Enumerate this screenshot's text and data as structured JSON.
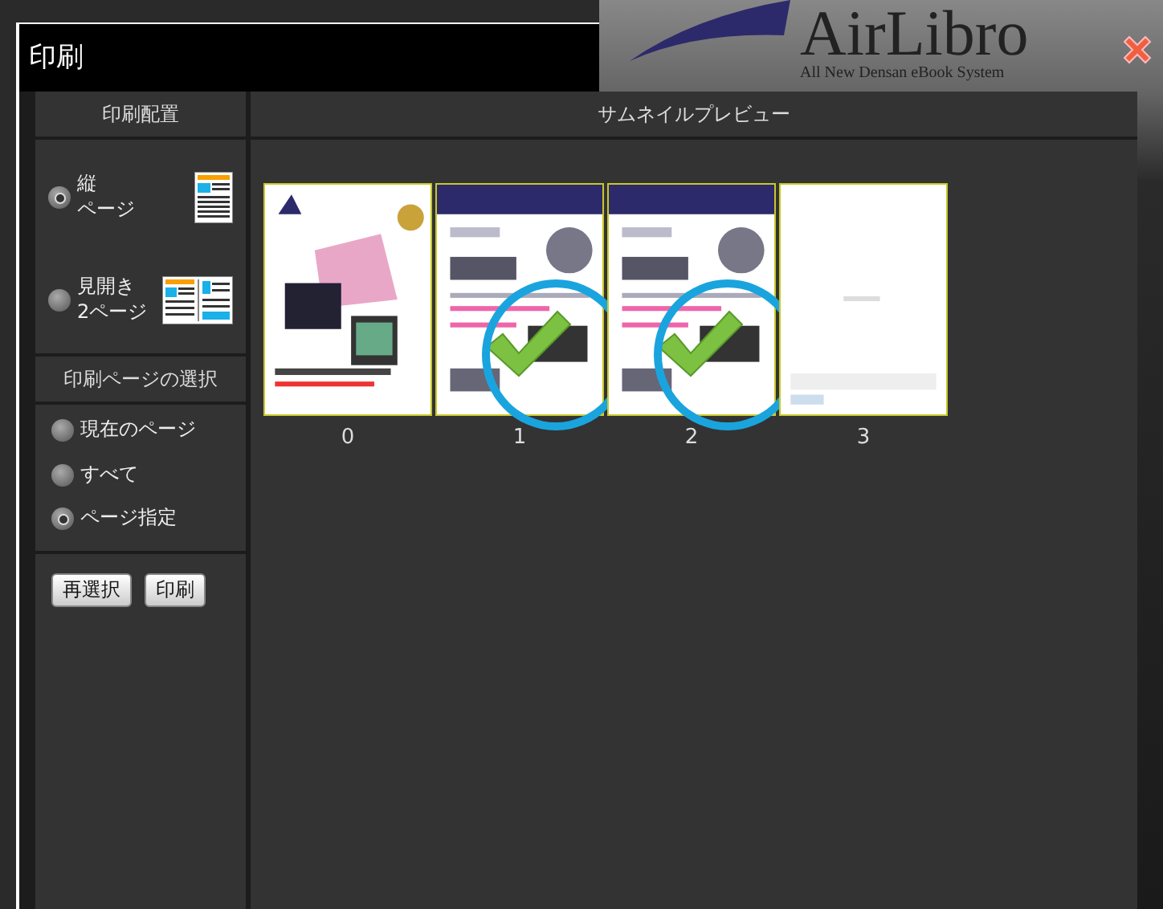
{
  "window": {
    "title": "印刷"
  },
  "background": {
    "logo": "AirLibro",
    "tagline": "All New Densan eBook System"
  },
  "layout_panel": {
    "header": "印刷配置",
    "options": [
      {
        "kind": "single",
        "label_lines": [
          "縦",
          "ページ"
        ],
        "selected": true
      },
      {
        "kind": "spread",
        "label_lines": [
          "見開き",
          "2ページ"
        ],
        "selected": false
      }
    ]
  },
  "page_selection": {
    "header": "印刷ページの選択",
    "options": [
      {
        "label": "現在のページ",
        "selected": false
      },
      {
        "label": "すべて",
        "selected": false
      },
      {
        "label": "ページ指定",
        "selected": true
      }
    ]
  },
  "buttons": [
    "再選択",
    "印刷"
  ],
  "preview": {
    "header": "サムネイルプレビュー",
    "pages": [
      {
        "number": "0",
        "kind": "cover",
        "selected": false
      },
      {
        "number": "1",
        "kind": "banner",
        "selected": true
      },
      {
        "number": "2",
        "kind": "banner",
        "selected": true
      },
      {
        "number": "3",
        "kind": "blank",
        "selected": false
      }
    ]
  }
}
